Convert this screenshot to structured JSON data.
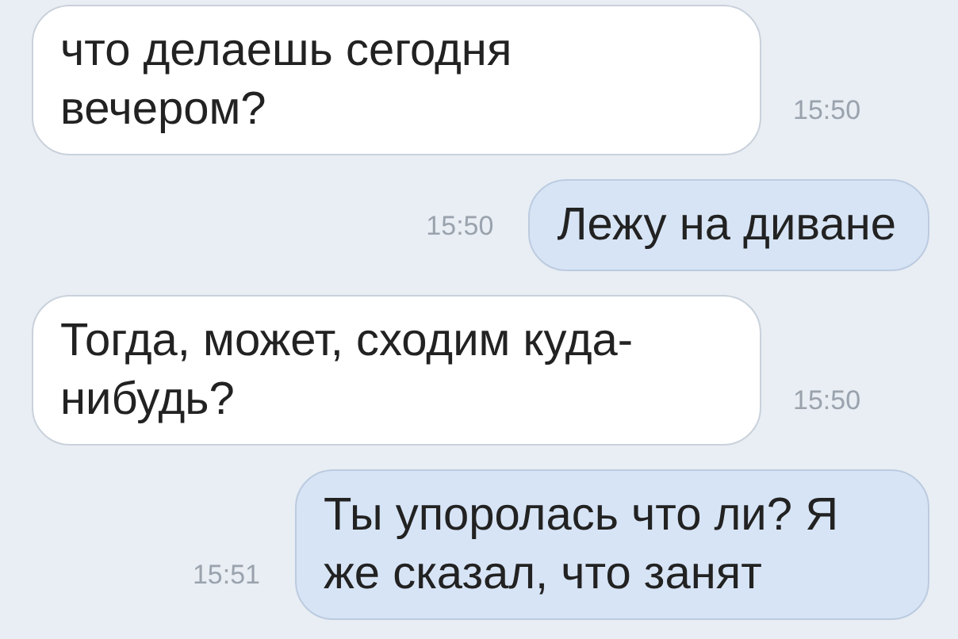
{
  "messages": [
    {
      "kind": "incoming",
      "text": "что делаешь сегодня вечером?",
      "time": "15:50"
    },
    {
      "kind": "outgoing",
      "text": "Лежу на диване",
      "time": "15:50"
    },
    {
      "kind": "incoming",
      "text": "Тогда, может, сходим куда-нибудь?",
      "time": "15:50"
    },
    {
      "kind": "outgoing",
      "text": "Ты упоролась что ли? Я же сказал, что занят",
      "time": "15:51"
    }
  ]
}
